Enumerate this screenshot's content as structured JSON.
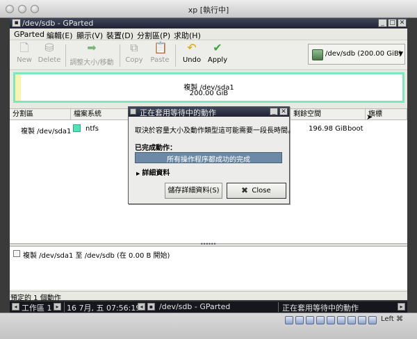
{
  "host": {
    "title": "xp [執行中]",
    "host_key": "Left ⌘"
  },
  "gparted": {
    "window_title": "/dev/sdb - GParted",
    "menu": [
      "GParted",
      "編輯(E)",
      "顯示(V)",
      "裝置(D)",
      "分割區(P)",
      "求助(H)"
    ],
    "toolbar": {
      "new": "New",
      "delete": "Delete",
      "resize_move": "調整大小/移動",
      "copy": "Copy",
      "paste": "Paste",
      "undo": "Undo",
      "apply": "Apply"
    },
    "device_selector": "/dev/sdb  (200.00 GiB)",
    "partition_graphic": {
      "line1": "複製 /dev/sda1",
      "line2": "200.00 GiB"
    },
    "table": {
      "headers": [
        "分割區",
        "檔案系統",
        "剩餘空間",
        "旗標"
      ],
      "rows": [
        {
          "partition": "複製 /dev/sda1",
          "filesystem": "ntfs",
          "unused": "196.98 GiB",
          "flags": "boot"
        }
      ]
    },
    "operations": [
      "複製 /dev/sda1 至 /dev/sdb (在 0.00 B 開始)"
    ],
    "statusbar": "預定的 1 個動作"
  },
  "taskbar": {
    "workspace": "工作區 1",
    "clock": "16 7月, 五 07:56:19",
    "window_task": "/dev/sdb - GParted",
    "dialog_task": "正在套用等待中的動作"
  },
  "dialog": {
    "title": "正在套用等待中的動作",
    "description": "取決於容量大小及動作類型這可能需要一段長時間。",
    "done_label": "已完成動作：",
    "progress_text": "所有操作程序都成功的完成",
    "progress_fraction": 1.0,
    "details_label": "詳細資料",
    "save_button": "儲存詳細資料(S)",
    "close_button": "Close"
  },
  "colors": {
    "partition_ntfs": "#4fe3b8",
    "progress": "#6c8aa6",
    "titlebar": "#2b3042"
  }
}
